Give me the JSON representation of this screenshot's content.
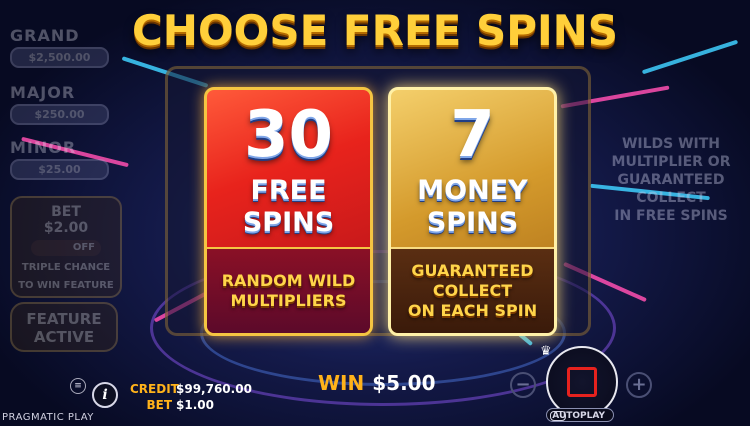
{
  "title": "CHOOSE FREE SPINS",
  "jackpots": [
    {
      "label": "GRAND",
      "value": "$2,500.00"
    },
    {
      "label": "MAJOR",
      "value": "$250.00"
    },
    {
      "label": "MINOR",
      "value": "$25.00"
    }
  ],
  "bet_panel": {
    "bet_label": "BET",
    "bet_value": "$2.00",
    "toggle_state": "OFF",
    "caption_line1": "TRIPLE CHANCE",
    "caption_line2": "TO WIN FEATURE"
  },
  "feature_panel": {
    "line1": "FEATURE",
    "line2": "ACTIVE"
  },
  "cards": [
    {
      "number": "30",
      "word1": "FREE",
      "word2": "SPINS",
      "desc": [
        "RANDOM WILD",
        "MULTIPLIERS"
      ]
    },
    {
      "number": "7",
      "word1": "MONEY",
      "word2": "SPINS",
      "desc": [
        "GUARANTEED",
        "COLLECT",
        "ON EACH SPIN"
      ]
    }
  ],
  "info_text": [
    "WILDS WITH",
    "MULTIPLIER OR",
    "GUARANTEED",
    "COLLECT",
    "IN FREE SPINS"
  ],
  "footer": {
    "brand": "PRAGMATIC PLAY",
    "credit_label": "CREDIT",
    "credit_value": "$99,760.00",
    "bet_label": "BET",
    "bet_value": "$1.00",
    "win_label": "WIN",
    "win_value": "$5.00",
    "autoplay_label": "AUTOPLAY",
    "minus_symbol": "−",
    "plus_symbol": "+",
    "info_symbol": "i"
  },
  "colors": {
    "accent_gold": "#ffcf3a",
    "label_orange": "#ffb21a",
    "stop_red": "#e6221e"
  },
  "icons": [
    "menu-icon",
    "info-icon",
    "minus-icon",
    "plus-icon",
    "stop-icon",
    "crown-icon",
    "autoplay-toggle-icon"
  ]
}
